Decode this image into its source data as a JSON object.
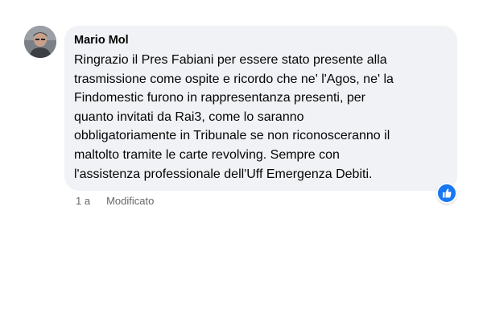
{
  "comment": {
    "author": "Mario Mol",
    "avatar_icon": "user-avatar-photo",
    "text_lines": [
      "Ringrazio il Pres Fabiani per essere stato presente alla",
      "trasmissione come ospite e ricordo che ne' l'Agos, ne' la",
      "Findomestic furono in rappresentanza presenti, per",
      "quanto invitati da Rai3, come lo saranno",
      "obbligatoriamente in Tribunale se non riconosceranno il",
      "maltolto tramite le carte revolving. Sempre con",
      "l'assistenza professionale dell'Uff Emergenza Debiti."
    ],
    "reaction_icon": "like-thumbs-up-icon",
    "reaction_color": "#1877f2",
    "timestamp": "1 a",
    "edited_label": "Modificato"
  }
}
